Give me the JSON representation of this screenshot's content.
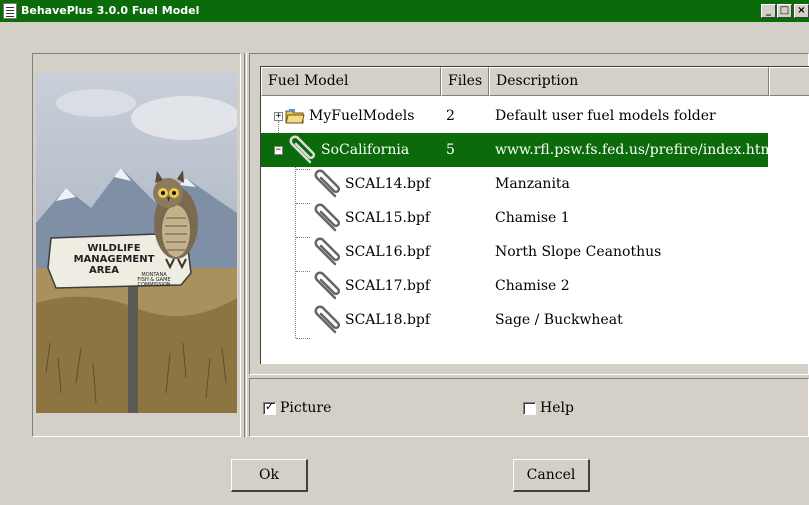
{
  "window": {
    "title": "BehavePlus 3.0.0 Fuel Model",
    "controls": {
      "minimize": "_",
      "maximize": "□",
      "close": "×"
    }
  },
  "picture": {
    "sign_lines": [
      "WILDLIFE",
      "MANAGEMENT",
      "AREA"
    ],
    "sign_small_lines": [
      "MONTANA",
      "FISH & GAME",
      "COMMISSION"
    ]
  },
  "tree": {
    "columns": [
      {
        "label": "Fuel Model"
      },
      {
        "label": "Files"
      },
      {
        "label": "Description"
      }
    ],
    "rows": [
      {
        "name": "MyFuelModels",
        "files": "2",
        "description": "Default user fuel models folder",
        "icon": "folder-icon",
        "expander": "+"
      },
      {
        "name": "SoCalifornia",
        "files": "5",
        "description": "www.rfl.psw.fs.fed.us/prefire/index.html",
        "icon": "paperclip-icon",
        "expander": "−",
        "selected": true
      },
      {
        "name": "SCAL14.bpf",
        "files": "",
        "description": "Manzanita",
        "icon": "paperclip-icon"
      },
      {
        "name": "SCAL15.bpf",
        "files": "",
        "description": "Chamise 1",
        "icon": "paperclip-icon"
      },
      {
        "name": "SCAL16.bpf",
        "files": "",
        "description": "North Slope Ceanothus",
        "icon": "paperclip-icon"
      },
      {
        "name": "SCAL17.bpf",
        "files": "",
        "description": "Chamise 2",
        "icon": "paperclip-icon"
      },
      {
        "name": "SCAL18.bpf",
        "files": "",
        "description": "Sage / Buckwheat",
        "icon": "paperclip-icon"
      }
    ]
  },
  "options": {
    "picture_label": "Picture",
    "picture_checked": true,
    "help_label": "Help",
    "help_checked": false
  },
  "buttons": {
    "ok": "Ok",
    "cancel": "Cancel"
  },
  "colors": {
    "title_bar": "#0b6b0b",
    "selection": "#0b6b0b",
    "face": "#d4d0c8"
  }
}
